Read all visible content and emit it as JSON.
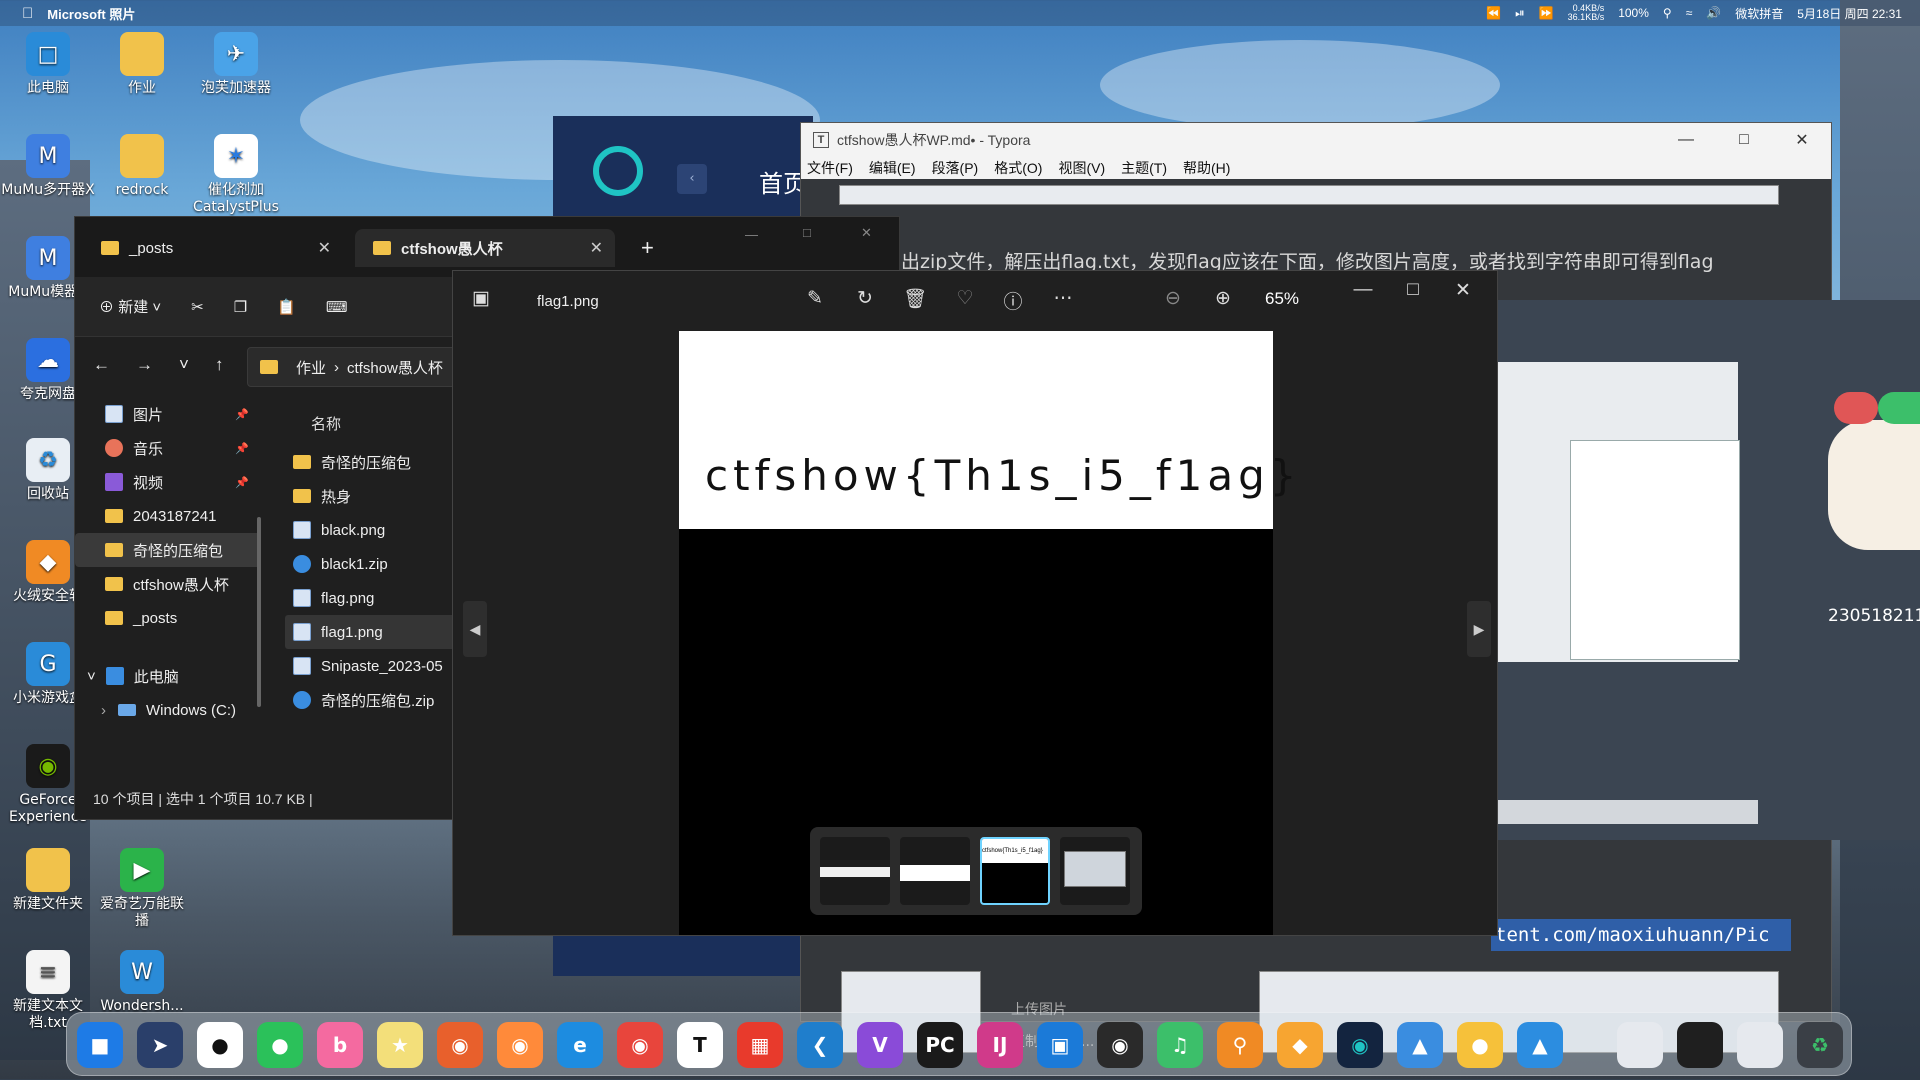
{
  "menubar": {
    "app_name": "Microsoft 照片",
    "net_up": "0.4KB/s",
    "net_down": "36.1KB/s",
    "battery": "100%",
    "ime": "微软拼音",
    "datetime": "5月18日 周四 22:31"
  },
  "desktop_icons": [
    {
      "label": "此电脑",
      "icon": "computer-icon"
    },
    {
      "label": "作业",
      "icon": "folder-icon"
    },
    {
      "label": "泡芙加速器",
      "icon": "accelerator-icon"
    },
    {
      "label": "MuMu多开器X",
      "icon": "mumu-icon"
    },
    {
      "label": "redrock",
      "icon": "folder-icon"
    },
    {
      "label": "催化剂加 CatalystPlus",
      "icon": "catalyst-icon"
    },
    {
      "label": "MuMu模器X",
      "icon": "mumu-icon"
    },
    {
      "label": "夸克网盘",
      "icon": "cloud-icon"
    },
    {
      "label": "回收站",
      "icon": "recycle-icon"
    },
    {
      "label": "火绒安全软",
      "icon": "shield-icon"
    },
    {
      "label": "小米游戏盒",
      "icon": "game-icon"
    },
    {
      "label": "GeForce Experience",
      "icon": "nvidia-icon"
    },
    {
      "label": "新建文件夹",
      "icon": "folder-icon"
    },
    {
      "label": "爱奇艺万能联播",
      "icon": "iqiyi-icon"
    },
    {
      "label": "新建文本文档.txt",
      "icon": "text-file-icon"
    },
    {
      "label": "Wondersh...",
      "icon": "wondershare-icon"
    }
  ],
  "teal_app": {
    "home_label": "首页"
  },
  "typora": {
    "title": "ctfshow愚人杯WP.md• - Typora",
    "menus": [
      "文件(F)",
      "编辑(E)",
      "段落(P)",
      "格式(O)",
      "视图(V)",
      "主题(T)",
      "帮助(H)"
    ],
    "body_text": "出zip文件，解压出flag.txt，发现flag应该在下面，修改图片高度，或者找到字符串即可得到flag",
    "code_text": "tent.com/maoxiuhuann/Pic",
    "ctx_items": [
      "上传图片",
      "复制图片到..."
    ],
    "side_text": "230518211"
  },
  "explorer": {
    "tabs": [
      {
        "label": "_posts"
      },
      {
        "label": "ctfshow愚人杯"
      }
    ],
    "toolbar_new": "新建",
    "path": [
      "作业",
      "ctfshow愚人杯"
    ],
    "column_header": "名称",
    "nav": [
      {
        "label": "图片",
        "pinned": true
      },
      {
        "label": "音乐",
        "pinned": true
      },
      {
        "label": "视频",
        "pinned": true
      },
      {
        "label": "2043187241",
        "pinned": false
      },
      {
        "label": "奇怪的压缩包",
        "pinned": false
      },
      {
        "label": "ctfshow愚人杯",
        "pinned": false
      },
      {
        "label": "_posts",
        "pinned": false
      },
      {
        "label": "此电脑",
        "pinned": false
      },
      {
        "label": "Windows (C:)",
        "pinned": false
      }
    ],
    "files": [
      {
        "name": "奇怪的压缩包",
        "type": "folder"
      },
      {
        "name": "热身",
        "type": "folder"
      },
      {
        "name": "black.png",
        "type": "png"
      },
      {
        "name": "black1.zip",
        "type": "zip"
      },
      {
        "name": "flag.png",
        "type": "png"
      },
      {
        "name": "flag1.png",
        "type": "png"
      },
      {
        "name": "Snipaste_2023-05",
        "type": "png"
      },
      {
        "name": "奇怪的压缩包.zip",
        "type": "zip"
      }
    ],
    "status": "10 个项目  |  选中 1 个项目  10.7 KB  |"
  },
  "photos": {
    "filename": "flag1.png",
    "zoom": "65%",
    "flag_text": "ctfshow{Th1s_i5_f1ag}",
    "thumb_caption": "ctfshow{Th1s_i5_f1ag}"
  },
  "colors": {
    "accent": "#6fd3ff",
    "typora_code_bg": "#2f5fa8",
    "teal": "#1fc4c4"
  }
}
